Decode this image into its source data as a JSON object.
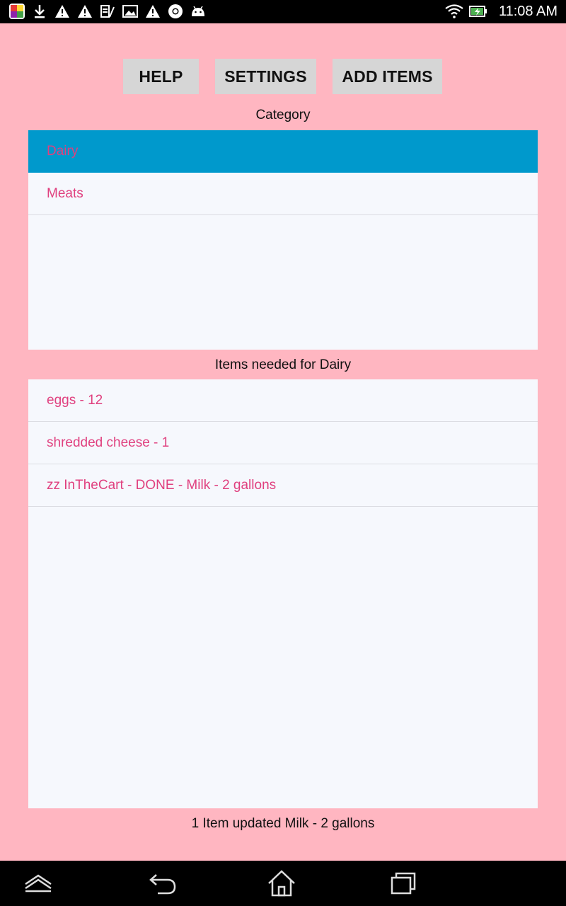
{
  "status_bar": {
    "time": "11:08 AM",
    "left_icons": [
      "app-icon",
      "download-icon",
      "warning-icon",
      "warning-icon",
      "sim-icon",
      "image-icon",
      "warning-icon",
      "chrome-icon",
      "android-icon"
    ],
    "right_icons": [
      "wifi-icon",
      "battery-charging-icon"
    ]
  },
  "toolbar": {
    "help_label": "HELP",
    "settings_label": "SETTINGS",
    "add_items_label": "ADD ITEMS"
  },
  "category": {
    "header": "Category",
    "items": [
      {
        "label": "Dairy",
        "selected": true
      },
      {
        "label": "Meats",
        "selected": false
      }
    ]
  },
  "items": {
    "header": "Items needed for Dairy",
    "list": [
      {
        "label": "eggs - 12"
      },
      {
        "label": "shredded cheese - 1"
      },
      {
        "label": "zz InTheCart - DONE - Milk - 2 gallons"
      }
    ]
  },
  "status_message": "1 Item updated Milk - 2 gallons",
  "colors": {
    "background": "#ffb6c1",
    "selected_row": "#0099cc",
    "item_text": "#e0407f",
    "panel": "#f6f8fd"
  },
  "nav_bar": {
    "icons": [
      "up-chevron-icon",
      "back-icon",
      "home-icon",
      "recent-apps-icon"
    ]
  }
}
